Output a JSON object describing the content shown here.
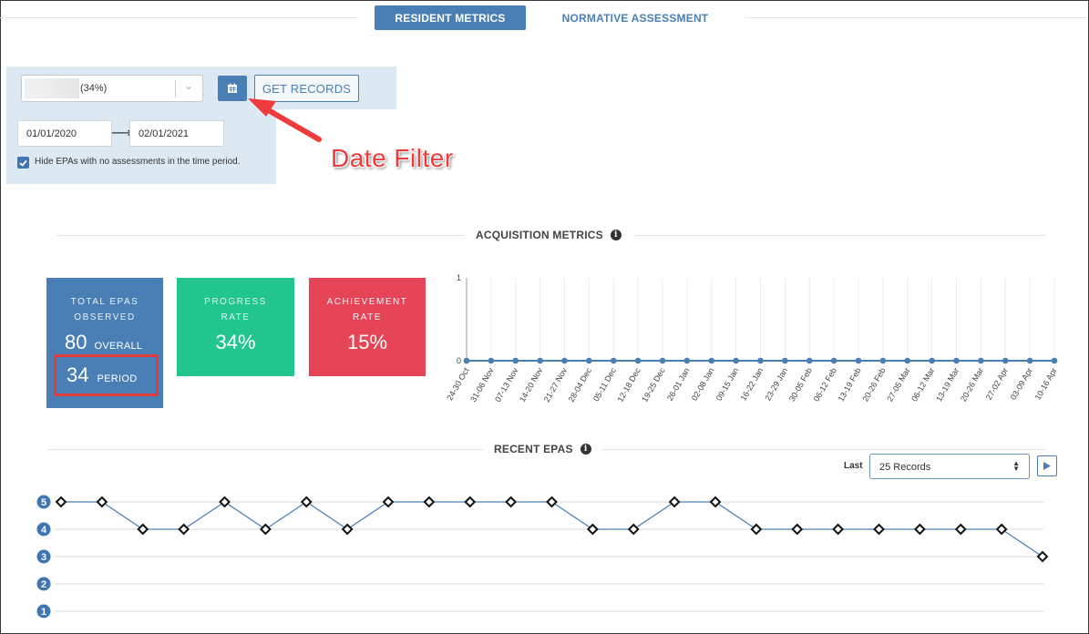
{
  "tabs": [
    {
      "label": "RESIDENT METRICS",
      "active": true
    },
    {
      "label": "NORMATIVE ASSESSMENT",
      "active": false
    }
  ],
  "filter": {
    "resident_select_value": "(34%)",
    "get_records_label": "GET RECORDS",
    "start_date": "01/01/2020",
    "end_date": "02/01/2021",
    "hide_empty_checked": true,
    "hide_empty_label": "Hide EPAs with no assessments in the time period."
  },
  "annotation": {
    "label": "Date Filter"
  },
  "acquisition": {
    "title": "ACQUISITION METRICS",
    "total": {
      "label_line1": "TOTAL EPAS",
      "label_line2": "OBSERVED",
      "overall_value": "80",
      "overall_label": "OVERALL",
      "period_value": "34",
      "period_label": "PERIOD"
    },
    "progress": {
      "label_line1": "PROGRESS",
      "label_line2": "RATE",
      "value": "34%"
    },
    "achievement": {
      "label_line1": "ACHIEVEMENT",
      "label_line2": "RATE",
      "value": "15%"
    }
  },
  "recent": {
    "title": "RECENT EPAS",
    "last_label": "Last",
    "records_value": "25 Records"
  },
  "colors": {
    "accent": "#4a7fb5",
    "green": "#21c58d",
    "red": "#e54556",
    "annotation": "#ef3b3b"
  },
  "chart_data": [
    {
      "type": "line",
      "name": "acquisition",
      "x": [
        "24-30 Oct",
        "31-06 Nov",
        "07-13 Nov",
        "14-20 Nov",
        "21-27 Nov",
        "28-04 Dec",
        "05-11 Dec",
        "12-18 Dec",
        "19-25 Dec",
        "26-01 Jan",
        "02-08 Jan",
        "09-15 Jan",
        "16-22 Jan",
        "23-29 Jan",
        "30-05 Feb",
        "06-12 Feb",
        "13-19 Feb",
        "20-26 Feb",
        "27-05 Mar",
        "06-12 Mar",
        "13-19 Mar",
        "20-26 Mar",
        "27-02 Apr",
        "03-09 Apr",
        "10-16 Apr"
      ],
      "values": [
        0,
        0,
        0,
        0,
        0,
        0,
        0,
        0,
        0,
        0,
        0,
        0,
        0,
        0,
        0,
        0,
        0,
        0,
        0,
        0,
        0,
        0,
        0,
        0,
        0
      ],
      "yticks": [
        "0",
        "1"
      ],
      "ylim": [
        0,
        1
      ],
      "grid": true
    },
    {
      "type": "line",
      "name": "recent-epas",
      "values": [
        5,
        5,
        4,
        4,
        5,
        4,
        5,
        4,
        5,
        5,
        5,
        5,
        5,
        4,
        4,
        5,
        5,
        4,
        4,
        4,
        4,
        4,
        4,
        4,
        3
      ],
      "yticks": [
        "1",
        "2",
        "3",
        "4",
        "5"
      ],
      "ylim": [
        1,
        5
      ],
      "grid": true
    }
  ]
}
